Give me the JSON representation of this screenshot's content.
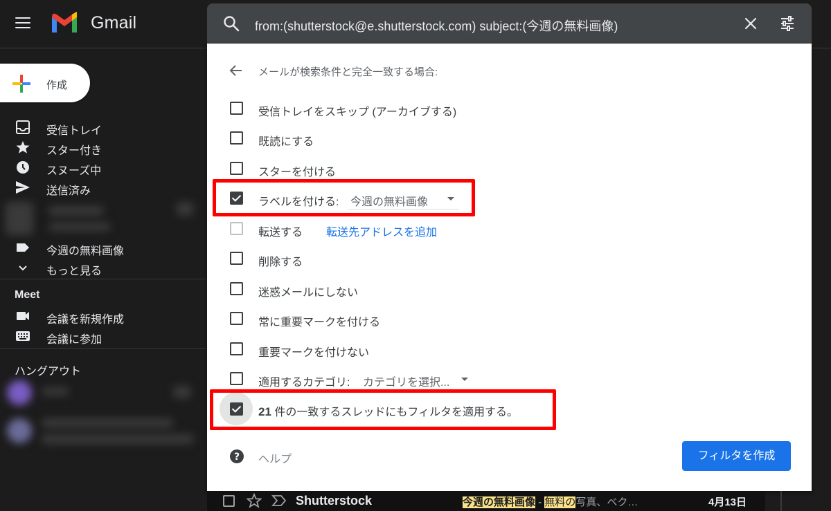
{
  "app": {
    "brand": "Gmail"
  },
  "sidebar": {
    "compose_label": "作成",
    "nav": [
      {
        "label": "受信トレイ",
        "icon": "inbox-icon"
      },
      {
        "label": "スター付き",
        "icon": "star-icon"
      },
      {
        "label": "スヌーズ中",
        "icon": "clock-icon"
      },
      {
        "label": "送信済み",
        "icon": "send-icon"
      }
    ],
    "labels": [
      {
        "label": "今週の無料画像",
        "icon": "label-icon"
      },
      {
        "label": "もっと見る",
        "icon": "chevron-down-icon"
      }
    ],
    "meet": {
      "title": "Meet",
      "items": [
        {
          "label": "会議を新規作成",
          "icon": "video-icon"
        },
        {
          "label": "会議に参加",
          "icon": "keyboard-icon"
        }
      ]
    },
    "hangouts_title": "ハングアウト"
  },
  "search": {
    "query": "from:(shutterstock@e.shutterstock.com) subject:(今週の無料画像)"
  },
  "filter": {
    "header": "メールが検索条件と完全一致する場合:",
    "options": [
      {
        "label": "受信トレイをスキップ (アーカイブする)",
        "checked": false
      },
      {
        "label": "既読にする",
        "checked": false
      },
      {
        "label": "スターを付ける",
        "checked": false
      },
      {
        "label": "ラベルを付ける:",
        "checked": true,
        "value": "今週の無料画像"
      },
      {
        "label": "転送する",
        "checked": false,
        "link": "転送先アドレスを追加"
      },
      {
        "label": "削除する",
        "checked": false
      },
      {
        "label": "迷惑メールにしない",
        "checked": false
      },
      {
        "label": "常に重要マークを付ける",
        "checked": false
      },
      {
        "label": "重要マークを付けない",
        "checked": false
      },
      {
        "label": "適用するカテゴリ:",
        "checked": false,
        "value": "カテゴリを選択..."
      },
      {
        "count": "21",
        "label": "件の一致するスレッドにもフィルタを適用する。",
        "checked": true
      }
    ],
    "help_label": "ヘルプ",
    "create_button": "フィルタを作成"
  },
  "mail_row": {
    "sender": "Shutterstock",
    "subject_hl": "今週の無料画像",
    "separator": " - ",
    "snippet_hl": "無料の",
    "snippet": "写真、ベク…",
    "date": "4月13日"
  },
  "colors": {
    "background": "#1c1c1c",
    "search_bar": "#424548",
    "accent_blue": "#1a73e8",
    "highlight_red": "#ff0000"
  }
}
